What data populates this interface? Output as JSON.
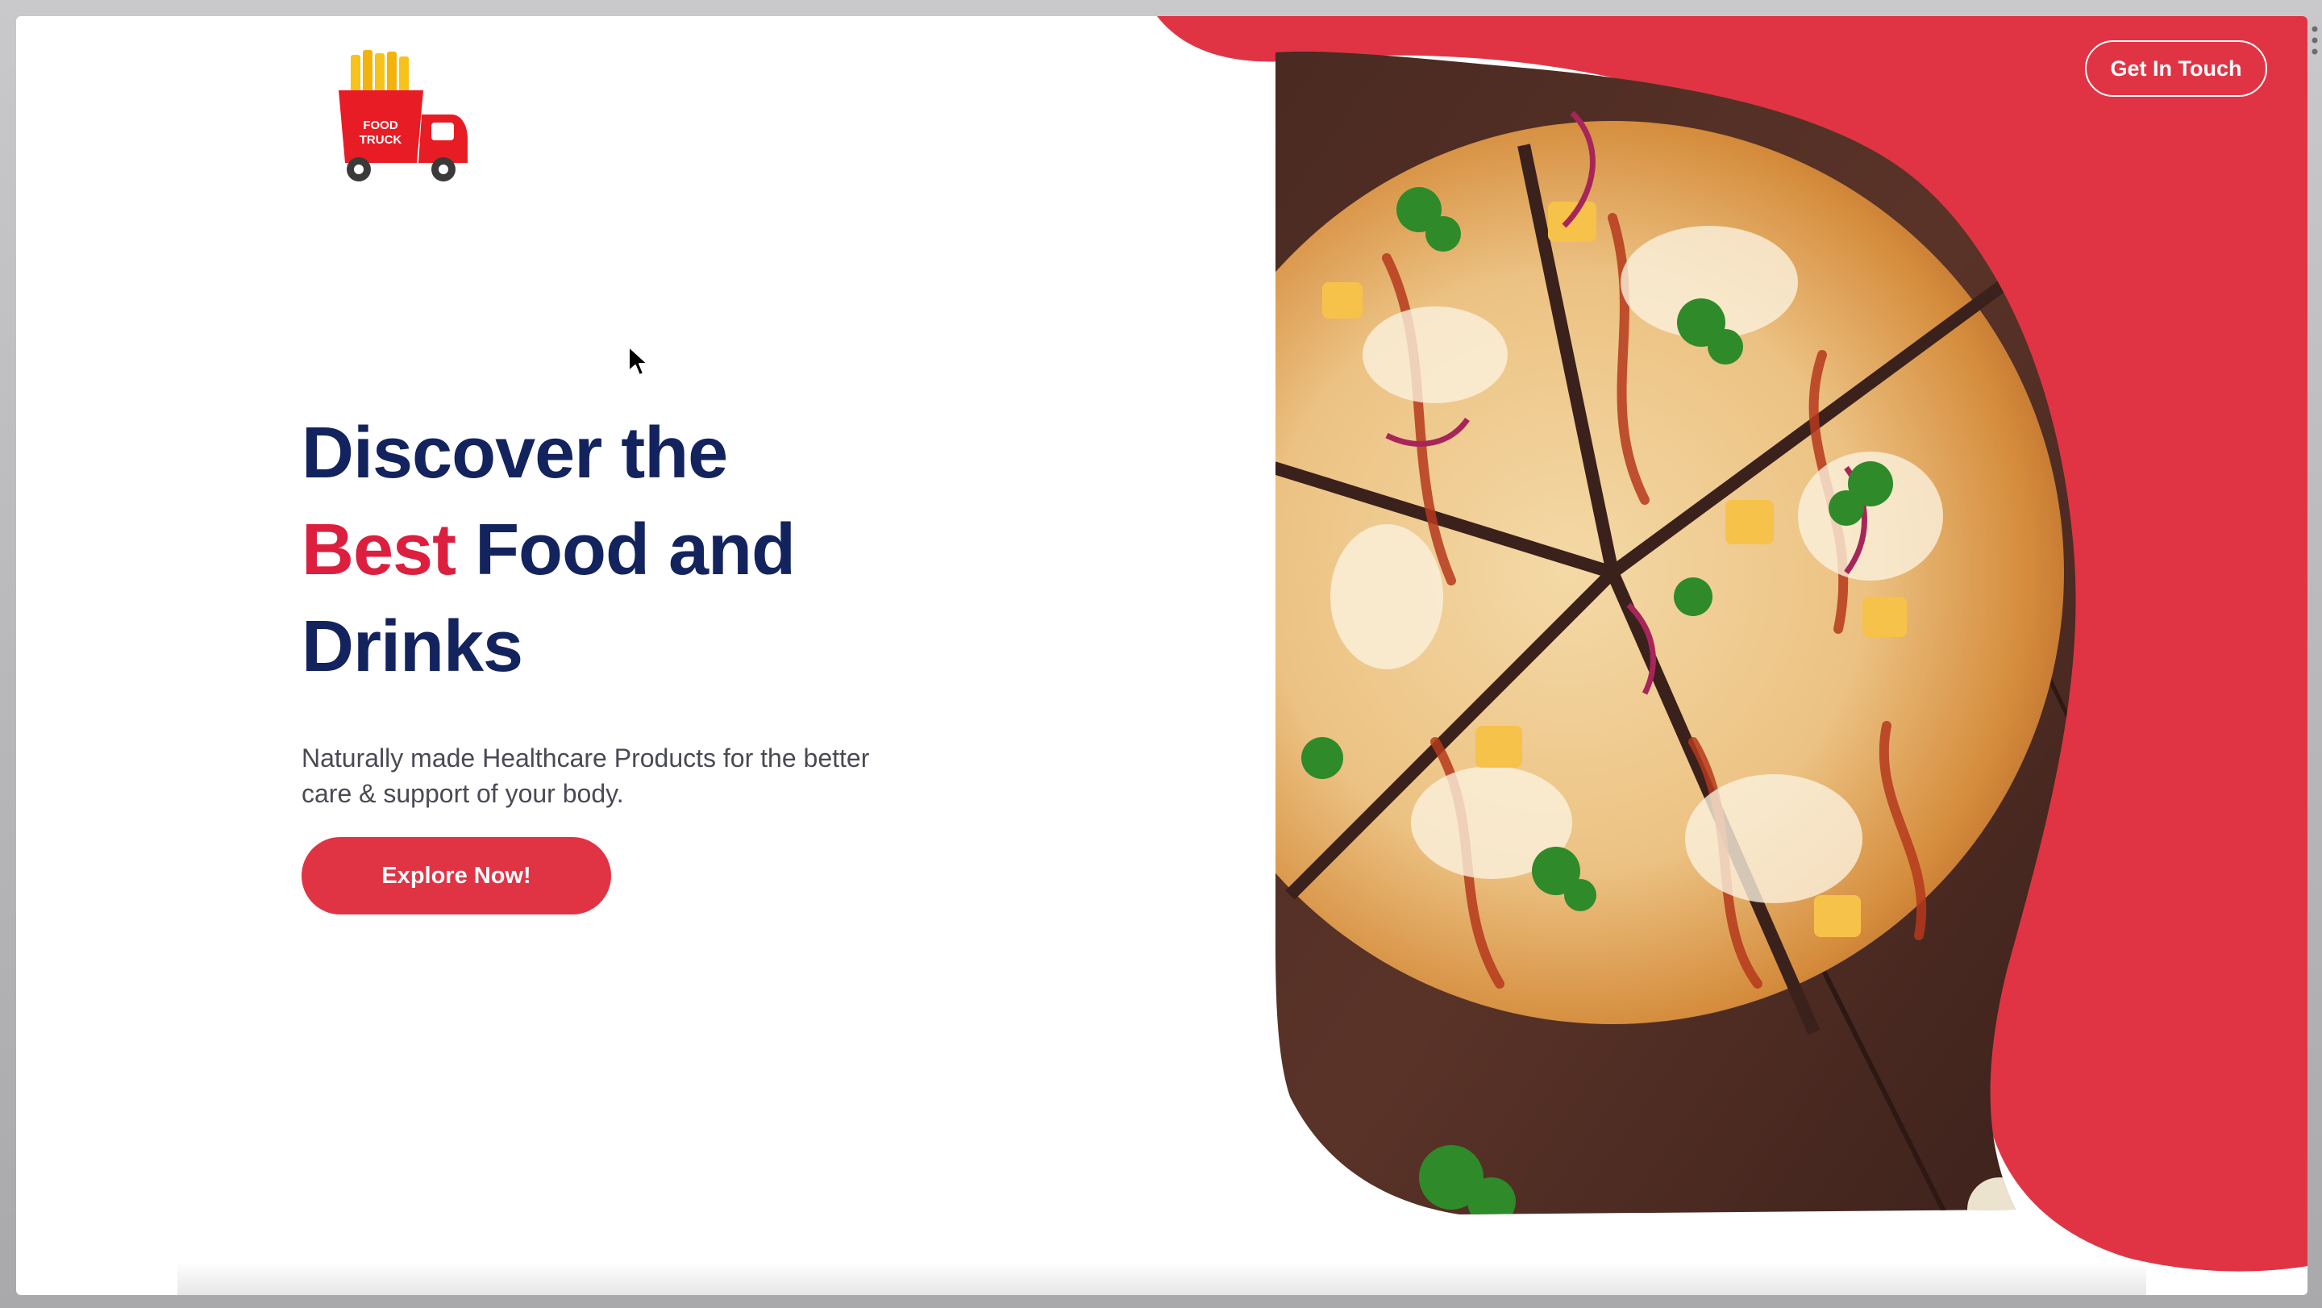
{
  "header": {
    "logo": {
      "line1": "FOOD",
      "line2": "TRUCK",
      "icon": "food-truck-fries-logo"
    },
    "cta_label": "Get In Touch"
  },
  "hero": {
    "title_line1": "Discover the",
    "title_accent": "Best",
    "title_line2_rest": " Food and",
    "title_line3": "Drinks",
    "subtitle": "Naturally made Healthcare Products for the better care & support of your body.",
    "button_label": "Explore Now!",
    "image": "pizza-photo"
  },
  "colors": {
    "brand_red": "#e03445",
    "accent_red": "#dc1f3f",
    "navy": "#13235e",
    "body_text": "#4a4a55"
  }
}
